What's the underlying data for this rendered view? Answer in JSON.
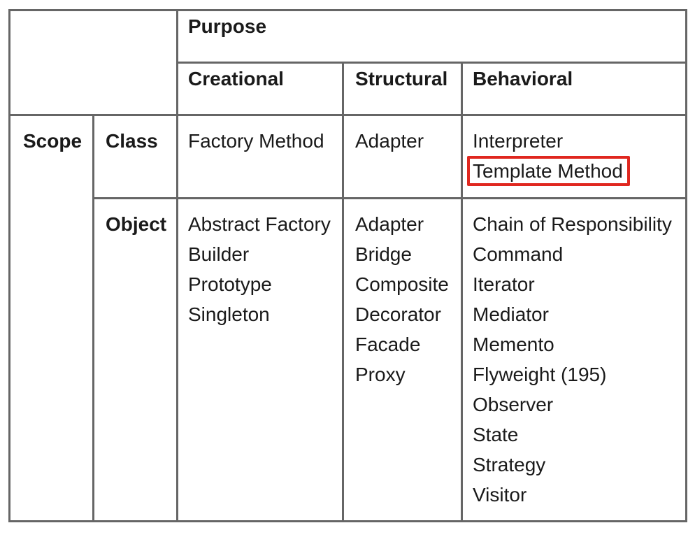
{
  "header": {
    "purpose": "Purpose",
    "categories": {
      "creational": "Creational",
      "structural": "Structural",
      "behavioral": "Behavioral"
    }
  },
  "scope": {
    "label": "Scope",
    "class_label": "Class",
    "object_label": "Object"
  },
  "class_row": {
    "creational": [
      "Factory Method"
    ],
    "structural": [
      "Adapter"
    ],
    "behavioral": [
      "Interpreter",
      "Template Method"
    ]
  },
  "object_row": {
    "creational": [
      "Abstract Factory",
      "Builder",
      "Prototype",
      "Singleton"
    ],
    "structural": [
      "Adapter",
      "Bridge",
      "Composite",
      "Decorator",
      "Facade",
      "Proxy"
    ],
    "behavioral": [
      "Chain of Responsibility",
      "Command",
      "Iterator",
      "Mediator",
      "Memento",
      "Flyweight (195)",
      "Observer",
      "State",
      "Strategy",
      "Visitor"
    ]
  },
  "highlight": {
    "item": "Template Method",
    "color": "#e0271f"
  },
  "colors": {
    "border": "#666666",
    "text": "#1a1a1a",
    "background": "#ffffff"
  }
}
